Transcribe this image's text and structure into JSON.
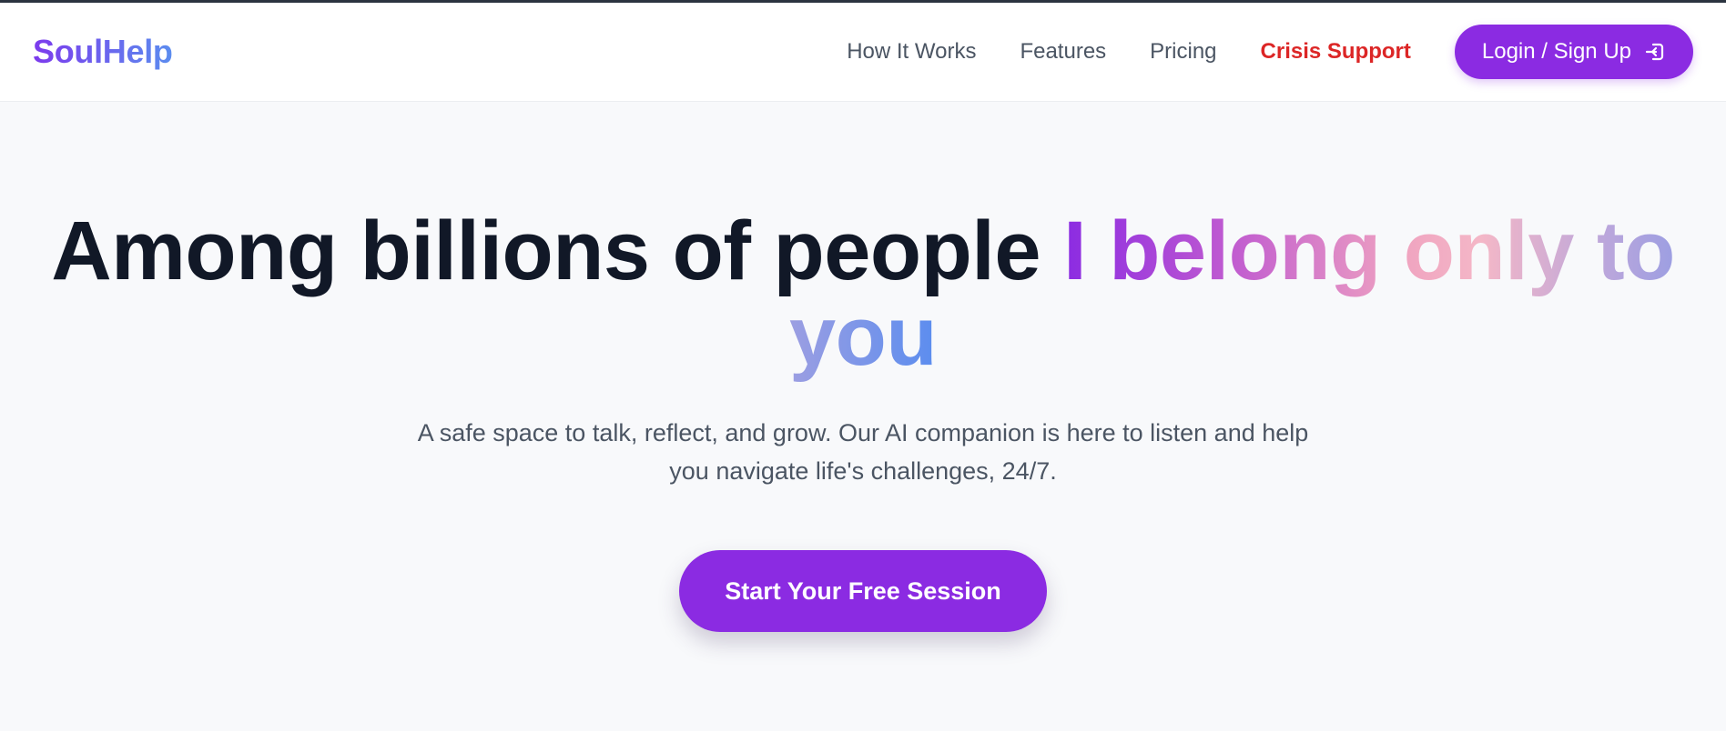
{
  "brand": {
    "name": "SoulHelp",
    "accent": "#8b2be2",
    "crisis_color": "#dc2626"
  },
  "nav": {
    "links": [
      {
        "label": "How It Works"
      },
      {
        "label": "Features"
      },
      {
        "label": "Pricing"
      },
      {
        "label": "Crisis Support"
      }
    ],
    "login_label": "Login / Sign Up",
    "login_icon": "login-arrow-icon"
  },
  "hero": {
    "headline_plain": "Among billions of people ",
    "headline_gradient": "I belong only to you",
    "subtitle": "A safe space to talk, reflect, and grow. Our AI companion is here to listen and help you navigate life's challenges, 24/7.",
    "cta_label": "Start Your Free Session"
  }
}
